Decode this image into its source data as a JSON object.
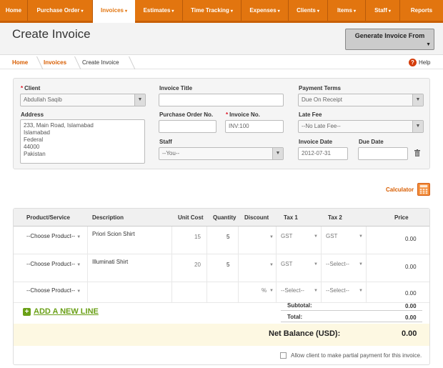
{
  "nav": {
    "items": [
      {
        "label": "Home",
        "caret": ""
      },
      {
        "label": "Purchase Order",
        "caret": "▾"
      },
      {
        "label": "Invoices",
        "caret": "▾"
      },
      {
        "label": "Estimates",
        "caret": "▾"
      },
      {
        "label": "Time Tracking",
        "caret": "▾"
      },
      {
        "label": "Expenses",
        "caret": "▾"
      },
      {
        "label": "Clients",
        "caret": "▾"
      },
      {
        "label": "Items",
        "caret": "▾"
      },
      {
        "label": "Staff",
        "caret": "▾"
      },
      {
        "label": "Reports",
        "caret": ""
      }
    ],
    "active": "Invoices"
  },
  "page": {
    "title": "Create Invoice",
    "generate_btn": "Generate Invoice From"
  },
  "breadcrumb": {
    "home": "Home",
    "invoices": "Invoices",
    "current": "Create Invoice",
    "help": "Help"
  },
  "form": {
    "client_label": "Client",
    "client_value": "Abdullah Saqib",
    "address_label": "Address",
    "address_lines": [
      "233, Main Road, Islamabad",
      "Islamabad",
      "Federal",
      "44000",
      "Pakistan"
    ],
    "invoice_title_label": "Invoice Title",
    "invoice_title_value": "",
    "po_label": "Purchase Order No.",
    "po_value": "",
    "invoice_no_label": "Invoice No.",
    "invoice_no_value": "INV:100",
    "staff_label": "Staff",
    "staff_value": "--You--",
    "payment_terms_label": "Payment Terms",
    "payment_terms_value": "Due On Receipt",
    "late_fee_label": "Late Fee",
    "late_fee_value": "--No Late Fee--",
    "invoice_date_label": "Invoice Date",
    "invoice_date_value": "2012-07-31",
    "due_date_label": "Due Date",
    "due_date_value": ""
  },
  "calculator": {
    "label": "Calculator"
  },
  "table": {
    "headers": [
      "Product/Service",
      "Description",
      "Unit Cost",
      "Quantity",
      "Discount",
      "Tax 1",
      "Tax 2",
      "Price"
    ],
    "rows": [
      {
        "product": "--Choose Product--",
        "description": "Priori Scion Shirt",
        "unit_cost": "15",
        "quantity": "5",
        "discount": "",
        "tax1": "GST",
        "tax2": "GST",
        "price": "0.00"
      },
      {
        "product": "--Choose Product--",
        "description": "Illuminati Shirt",
        "unit_cost": "20",
        "quantity": "5",
        "discount": "",
        "tax1": "GST",
        "tax2": "--Select--",
        "price": "0.00"
      },
      {
        "product": "--Choose Product--",
        "description": "",
        "unit_cost": "",
        "quantity": "",
        "discount": "%",
        "tax1": "--Select--",
        "tax2": "--Select--",
        "price": "0.00"
      }
    ],
    "add_line": "ADD A NEW LINE",
    "subtotal_label": "Subtotal:",
    "subtotal_value": "0.00",
    "total_label": "Total:",
    "total_value": "0.00",
    "net_label": "Net Balance (USD):",
    "net_value": "0.00",
    "partial_label": "Allow client to make partial payment for this invoice."
  },
  "colors": {
    "accent": "#e2750f",
    "link": "#d85d00",
    "add_line": "#6aa017"
  }
}
